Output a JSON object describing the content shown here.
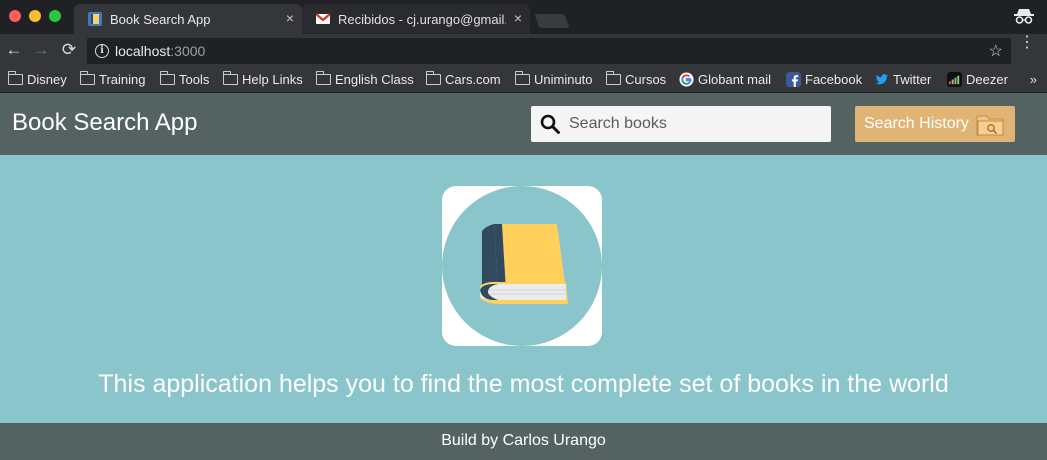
{
  "browser": {
    "tabs": [
      {
        "title": "Book Search App",
        "close": "×",
        "active": true,
        "favicon": "book-favicon"
      },
      {
        "title": "Recibidos - cj.urango@gmail.com",
        "close": "×",
        "active": false,
        "favicon": "gmail-favicon"
      }
    ],
    "address_bar": {
      "host": "localhost",
      "port": ":3000"
    },
    "nav": {
      "back": "←",
      "forward": "→",
      "reload": "⟳",
      "star": "☆",
      "menu": "⋮",
      "info": "i"
    },
    "bookmarks": [
      {
        "label": "Disney",
        "icon": "folder-icon"
      },
      {
        "label": "Training",
        "icon": "folder-icon"
      },
      {
        "label": "Tools",
        "icon": "folder-icon"
      },
      {
        "label": "Help Links",
        "icon": "folder-icon"
      },
      {
        "label": "English Class",
        "icon": "folder-icon"
      },
      {
        "label": "Cars.com",
        "icon": "folder-icon"
      },
      {
        "label": "Uniminuto",
        "icon": "folder-icon"
      },
      {
        "label": "Cursos",
        "icon": "folder-icon"
      },
      {
        "label": "Globant mail",
        "icon": "google-icon"
      },
      {
        "label": "Facebook",
        "icon": "facebook-icon"
      },
      {
        "label": "Twitter",
        "icon": "twitter-icon"
      },
      {
        "label": "Deezer",
        "icon": "deezer-icon"
      }
    ],
    "bookmarks_overflow": "»"
  },
  "app": {
    "title": "Book Search App",
    "search": {
      "placeholder": "Search books",
      "value": ""
    },
    "history_button": "Search History",
    "tagline": "This application helps you to find the most complete set of books in the world",
    "footer": "Build by Carlos Urango"
  },
  "colors": {
    "header": "#546262",
    "main_bg": "#8ac5cc",
    "history_button": "#e0b474",
    "book_cover": "#ffd05b",
    "book_spine": "#324a5e"
  }
}
